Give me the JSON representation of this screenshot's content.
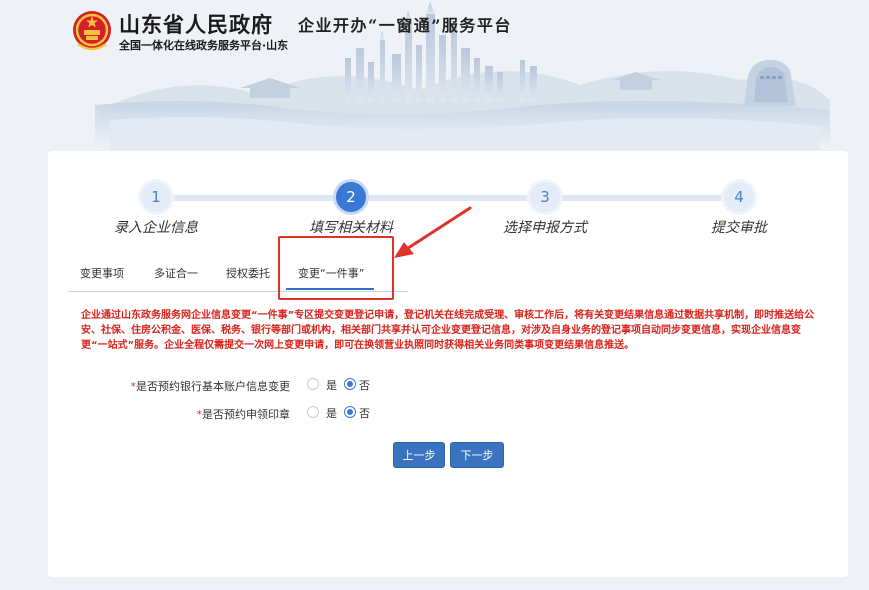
{
  "header": {
    "gov_title": "山东省人民政府",
    "gov_subtitle": "全国一体化在线政务服务平台·山东",
    "platform_title": "企业开办“一窗通”服务平台"
  },
  "steps": [
    {
      "number": "1",
      "label": "录入企业信息"
    },
    {
      "number": "2",
      "label": "填写相关材料"
    },
    {
      "number": "3",
      "label": "选择申报方式"
    },
    {
      "number": "4",
      "label": "提交审批"
    }
  ],
  "active_step": 2,
  "tabs": [
    {
      "label": "变更事项"
    },
    {
      "label": "多证合一"
    },
    {
      "label": "授权委托"
    },
    {
      "label": "变更“一件事”"
    }
  ],
  "active_tab": 3,
  "notice": "企业通过山东政务服务网企业信息变更“一件事”专区提交变更登记申请，登记机关在线完成受理、审核工作后，将有关变更结果信息通过数据共享机制，即时推送给公安、社保、住房公积金、医保、税务、银行等部门或机构，相关部门共享并认可企业变更登记信息，对涉及自身业务的登记事项自动同步变更信息，实现企业信息变更“一站式”服务。企业全程仅需提交一次网上变更申请，即可在换领营业执照同时获得相关业务同类事项变更结果信息推送。",
  "form": {
    "rows": [
      {
        "required": "*",
        "label": "是否预约银行基本账户信息变更",
        "yes": "是",
        "no": "否",
        "selected": "no"
      },
      {
        "required": "*",
        "label": "是否预约申领印章",
        "yes": "是",
        "no": "否",
        "selected": "no"
      }
    ]
  },
  "buttons": {
    "prev": "上一步",
    "next": "下一步"
  },
  "colors": {
    "accent": "#3a78d6",
    "button": "#3a73c0",
    "notice": "#d9251d",
    "highlight": "#e0312b"
  }
}
